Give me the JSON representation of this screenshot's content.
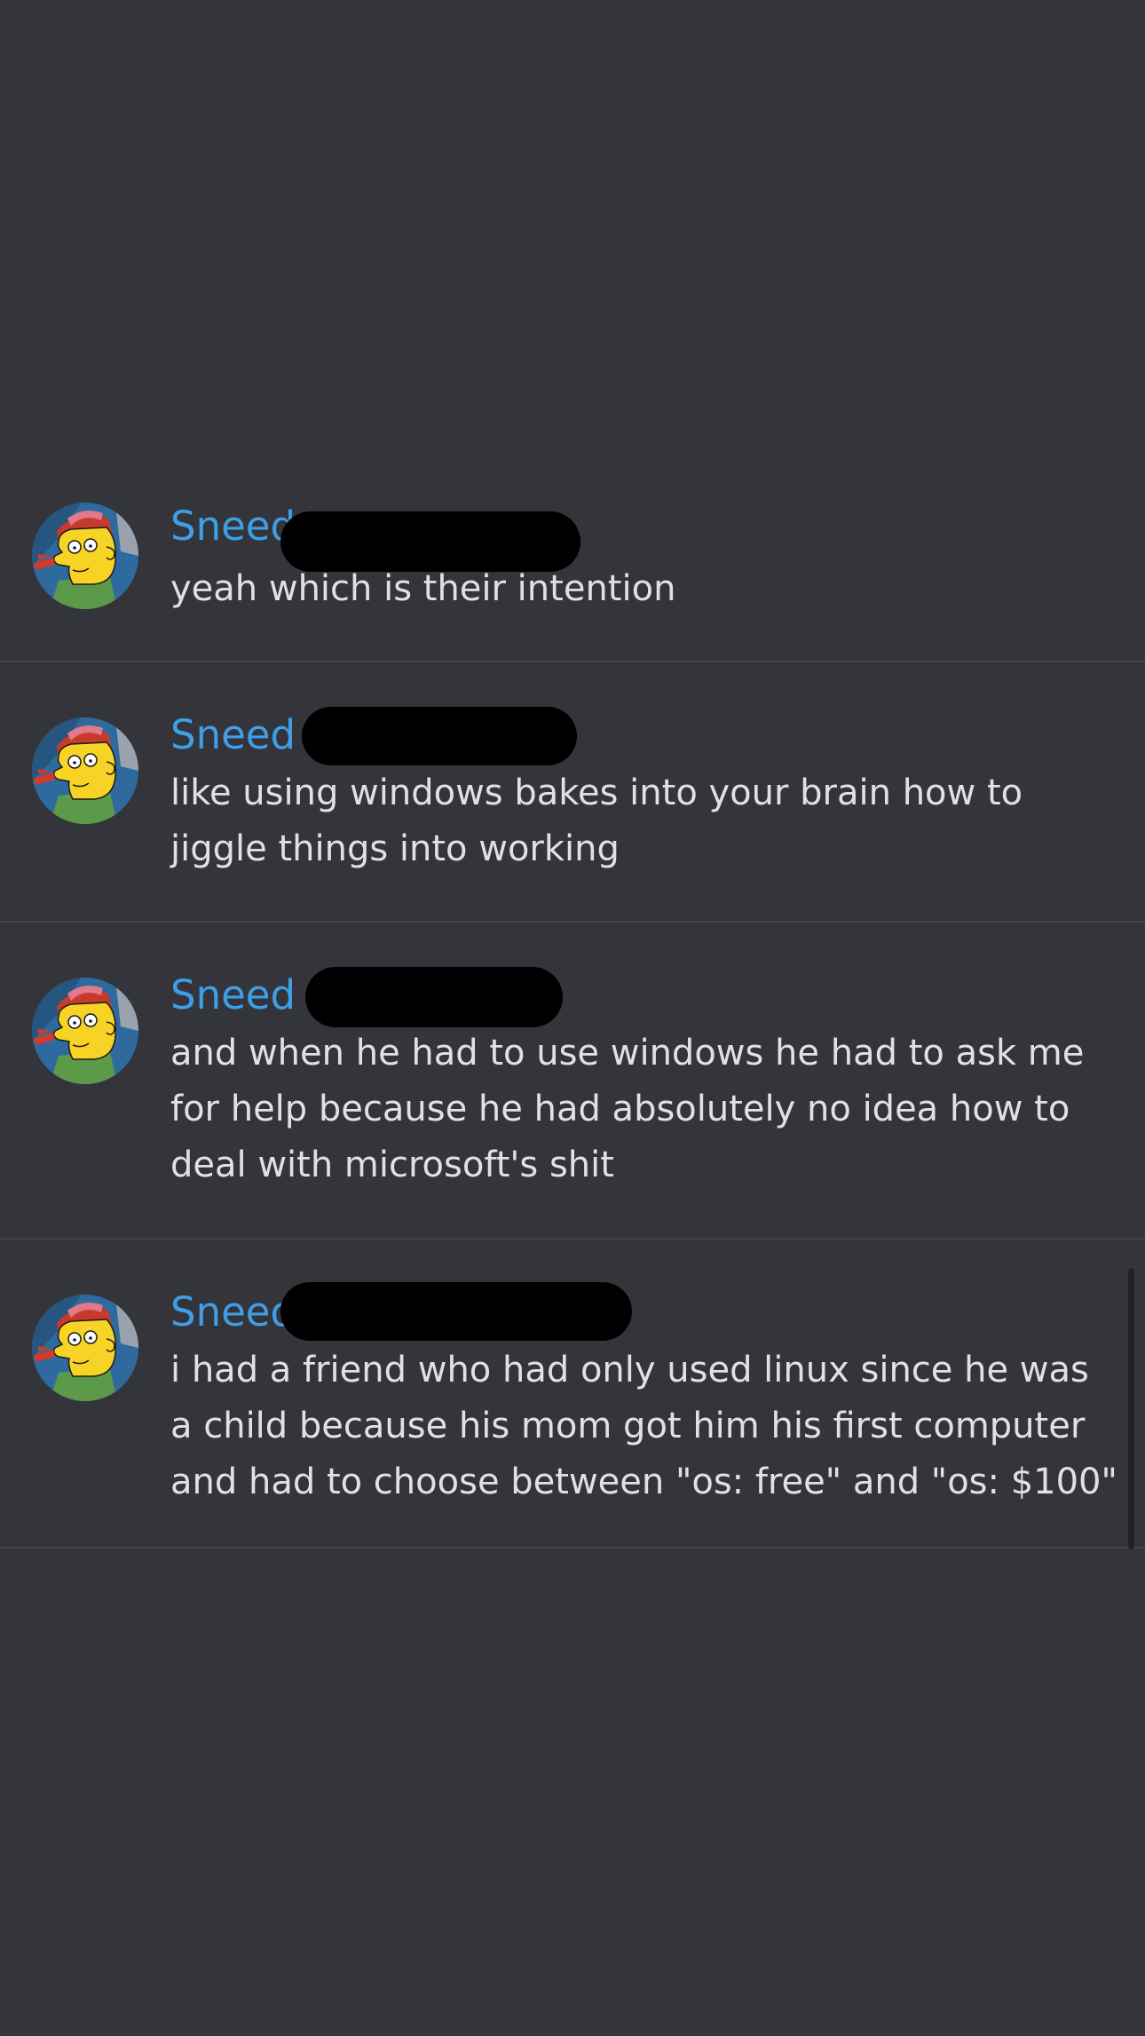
{
  "messages": [
    {
      "username": "Sneed",
      "avatar_icon": "simpsons-cartoon-avatar-icon",
      "text": "yeah which is their intention"
    },
    {
      "username": "Sneed",
      "avatar_icon": "simpsons-cartoon-avatar-icon",
      "text": "like using windows bakes into your brain how to jiggle things into working"
    },
    {
      "username": "Sneed",
      "avatar_icon": "simpsons-cartoon-avatar-icon",
      "text": "and when he had to use windows he had to ask me for help because he had absolutely no idea how to deal with microsoft's shit"
    },
    {
      "username": "Sneed",
      "avatar_icon": "simpsons-cartoon-avatar-icon",
      "text": "i had a friend who had only used linux since he was a child because his mom got him his first computer and had to choose between \"os: free\" and \"os: $100\""
    }
  ],
  "colors": {
    "background": "#33353b",
    "username": "#3f9fe6",
    "message_text": "#dfe1e5",
    "divider": "#42454b",
    "redaction": "#000000"
  }
}
